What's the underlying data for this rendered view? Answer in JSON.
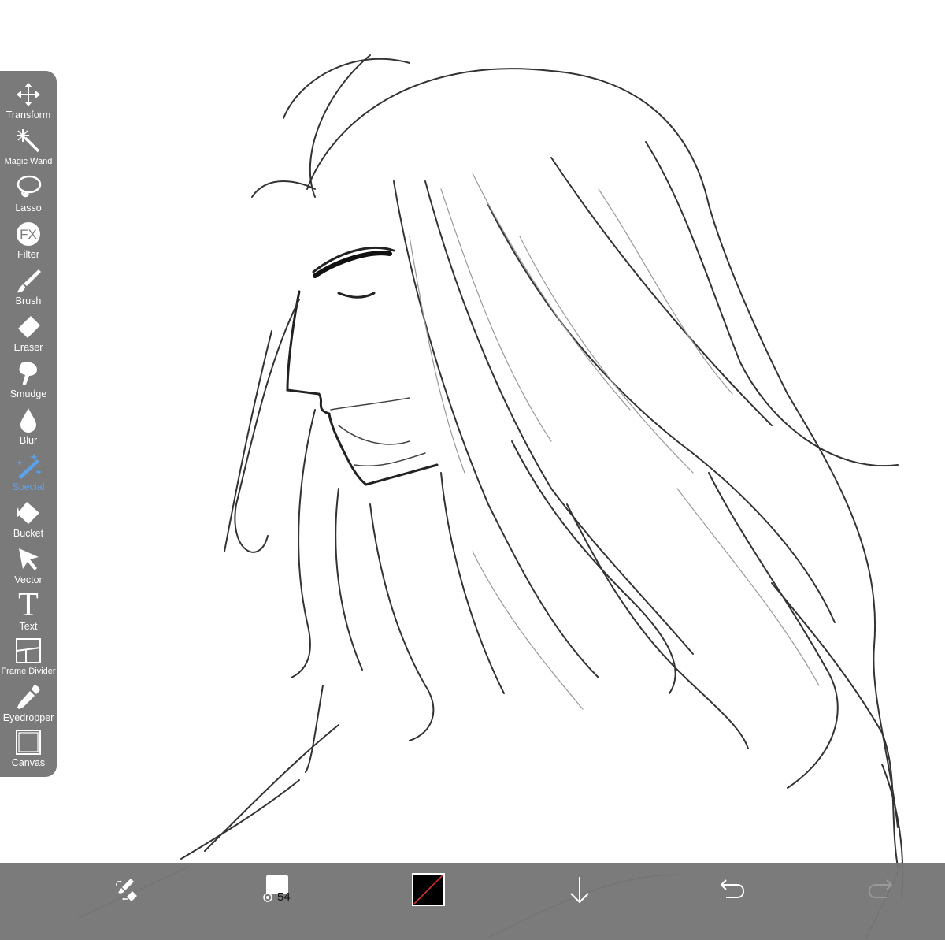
{
  "toolbar": {
    "tools": [
      {
        "label": "Transform",
        "icon": "move-arrows-icon",
        "active": false
      },
      {
        "label": "Magic Wand",
        "icon": "magic-wand-icon",
        "active": false
      },
      {
        "label": "Lasso",
        "icon": "lasso-icon",
        "active": false
      },
      {
        "label": "Filter",
        "icon": "fx-icon",
        "icon_text": "FX",
        "active": false
      },
      {
        "label": "Brush",
        "icon": "brush-icon",
        "active": false
      },
      {
        "label": "Eraser",
        "icon": "eraser-icon",
        "active": false
      },
      {
        "label": "Smudge",
        "icon": "smudge-finger-icon",
        "active": false
      },
      {
        "label": "Blur",
        "icon": "drop-icon",
        "active": false
      },
      {
        "label": "Special",
        "icon": "special-wand-icon",
        "active": true
      },
      {
        "label": "Bucket",
        "icon": "bucket-icon",
        "active": false
      },
      {
        "label": "Vector",
        "icon": "cursor-arrow-icon",
        "active": false
      },
      {
        "label": "Text",
        "icon": "text-t-icon",
        "icon_text": "T",
        "active": false
      },
      {
        "label": "Frame Divider",
        "icon": "frame-divider-icon",
        "active": false
      },
      {
        "label": "Eyedropper",
        "icon": "eyedropper-icon",
        "active": false
      },
      {
        "label": "Canvas",
        "icon": "canvas-square-icon",
        "active": false
      }
    ],
    "active_color": "#5aa2ee"
  },
  "bottom_bar": {
    "quick_switch_icon": "brush-eraser-swap-icon",
    "brush_size": "54",
    "brush_size_icon": "brush-size-swatch-icon",
    "color_swatch_icon": "color-swatch-icon",
    "primary_color": "#000000",
    "layer_icon": "down-arrow-icon",
    "undo_icon": "undo-icon",
    "redo_icon": "redo-icon"
  },
  "canvas": {
    "content": "sketch-drawing",
    "background": "#ffffff"
  }
}
